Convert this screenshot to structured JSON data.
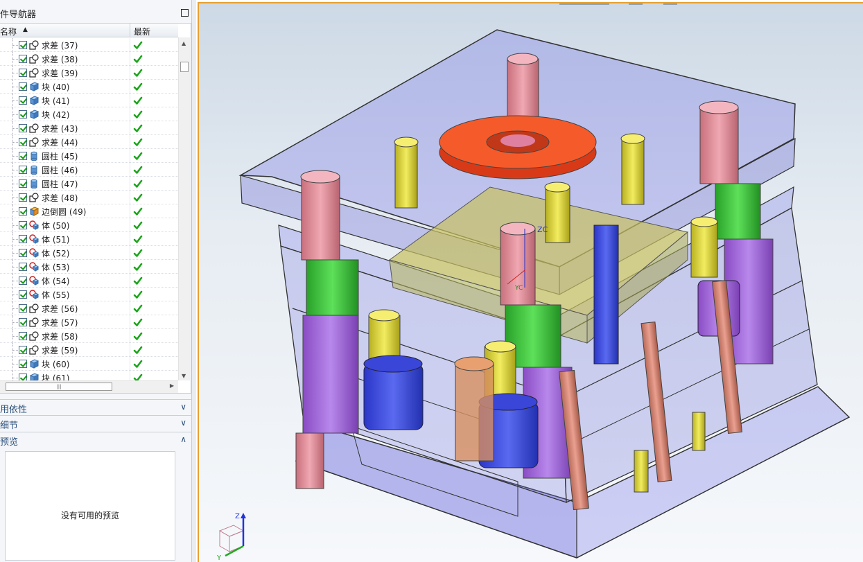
{
  "panel": {
    "title": "件导航器",
    "column_name": "名称",
    "column_latest": "最新",
    "sort_glyph": "▲"
  },
  "tree_rows": [
    {
      "label": "求差 (37)",
      "icon": "subtract-icon"
    },
    {
      "label": "求差 (38)",
      "icon": "subtract-icon"
    },
    {
      "label": "求差 (39)",
      "icon": "subtract-icon"
    },
    {
      "label": "块 (40)",
      "icon": "block-icon"
    },
    {
      "label": "块 (41)",
      "icon": "block-icon"
    },
    {
      "label": "块 (42)",
      "icon": "block-icon"
    },
    {
      "label": "求差 (43)",
      "icon": "subtract-icon"
    },
    {
      "label": "求差 (44)",
      "icon": "subtract-icon"
    },
    {
      "label": "圆柱 (45)",
      "icon": "cylinder-icon"
    },
    {
      "label": "圆柱 (46)",
      "icon": "cylinder-icon"
    },
    {
      "label": "圆柱 (47)",
      "icon": "cylinder-icon"
    },
    {
      "label": "求差 (48)",
      "icon": "subtract-icon"
    },
    {
      "label": "边倒圆 (49)",
      "icon": "edge-blend-icon"
    },
    {
      "label": "体 (50)",
      "icon": "body-icon"
    },
    {
      "label": "体 (51)",
      "icon": "body-icon"
    },
    {
      "label": "体 (52)",
      "icon": "body-icon"
    },
    {
      "label": "体 (53)",
      "icon": "body-icon"
    },
    {
      "label": "体 (54)",
      "icon": "body-icon"
    },
    {
      "label": "体 (55)",
      "icon": "body-icon"
    },
    {
      "label": "求差 (56)",
      "icon": "subtract-icon"
    },
    {
      "label": "求差 (57)",
      "icon": "subtract-icon"
    },
    {
      "label": "求差 (58)",
      "icon": "subtract-icon"
    },
    {
      "label": "求差 (59)",
      "icon": "subtract-icon"
    },
    {
      "label": "块 (60)",
      "icon": "block-icon"
    },
    {
      "label": "块 (61)",
      "icon": "block-icon"
    }
  ],
  "sections": {
    "dependencies": "用依性",
    "details": "细节",
    "preview": "预览",
    "preview_empty": "没有可用的预览"
  },
  "viewport": {
    "axis_label_zc": "ZC",
    "axis_label_yc": "YC",
    "triad_z": "Z",
    "triad_y": "Y",
    "accent_color": "#e8a030"
  }
}
